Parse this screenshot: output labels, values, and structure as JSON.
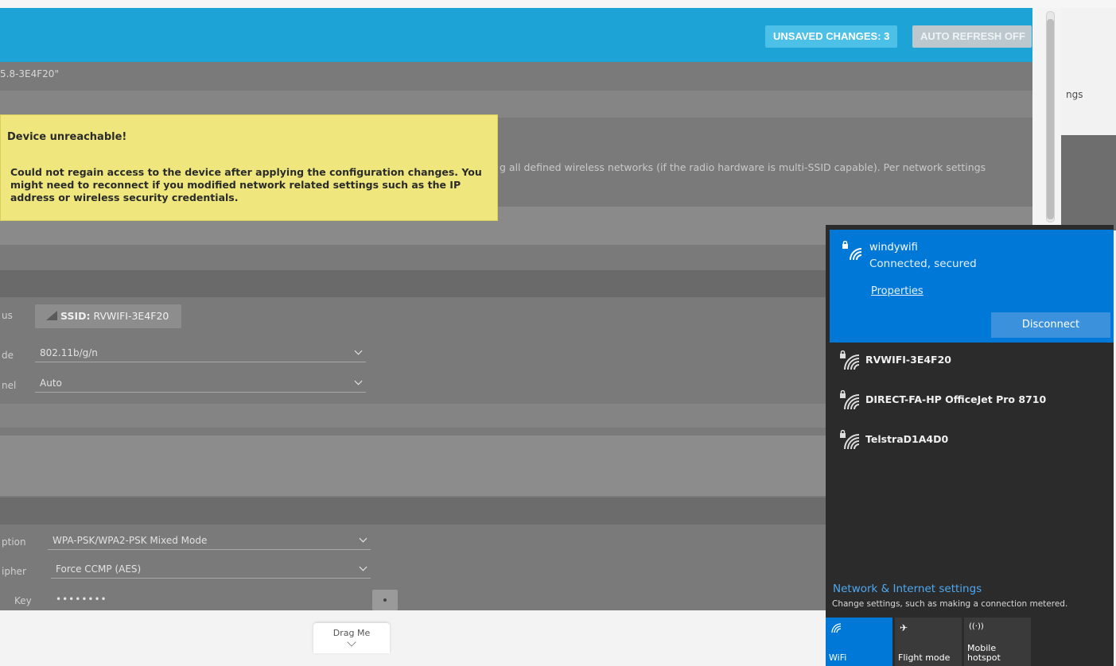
{
  "header": {
    "unsaved_changes": "UNSAVED CHANGES: 3",
    "auto_refresh": "AUTO REFRESH OFF"
  },
  "page": {
    "device_id": "5.8-3E4F20\"",
    "right_truncated": "ngs",
    "description": "g all defined wireless networks (if the radio hardware is multi-SSID capable). Per network settings"
  },
  "alert": {
    "title": "Device unreachable!",
    "message": "Could not regain access to the device after applying the configuration changes. You might need to reconnect if you modified network related settings such as the IP address or wireless security credentials."
  },
  "form": {
    "status_label": "us",
    "ssid_prefix": "SSID:",
    "ssid_value": "RVWIFI-3E4F20",
    "mode_label": "de",
    "mode_value": "802.11b/g/n",
    "channel_label": "nel",
    "channel_value": "Auto",
    "encryption_label": "ption",
    "encryption_value": "WPA-PSK/WPA2-PSK Mixed Mode",
    "cipher_label": "ipher",
    "cipher_value": "Force CCMP (AES)",
    "key_label": "Key",
    "key_value": "••••••••"
  },
  "footer": {
    "drag_label": "Drag Me"
  },
  "flyout": {
    "connected": {
      "name": "windywifi",
      "status": "Connected, secured",
      "properties": "Properties",
      "disconnect": "Disconnect"
    },
    "networks": [
      {
        "name": "RVWIFI-3E4F20"
      },
      {
        "name": "DIRECT-FA-HP OfficeJet Pro 8710"
      },
      {
        "name": "TelstraD1A4D0"
      }
    ],
    "settings_title": "Network & Internet settings",
    "settings_subtitle": "Change settings, such as making a connection metered.",
    "tiles": [
      {
        "label": "WiFi",
        "icon": "wifi-icon"
      },
      {
        "label": "Flight mode",
        "icon": "airplane-icon"
      },
      {
        "label": "Mobile\nhotspot",
        "icon": "hotspot-icon"
      }
    ]
  },
  "colors": {
    "header": "#1da3d6",
    "alert": "#efe77d",
    "flyout_bg": "#2b2b2b",
    "accent": "#0078d7"
  }
}
